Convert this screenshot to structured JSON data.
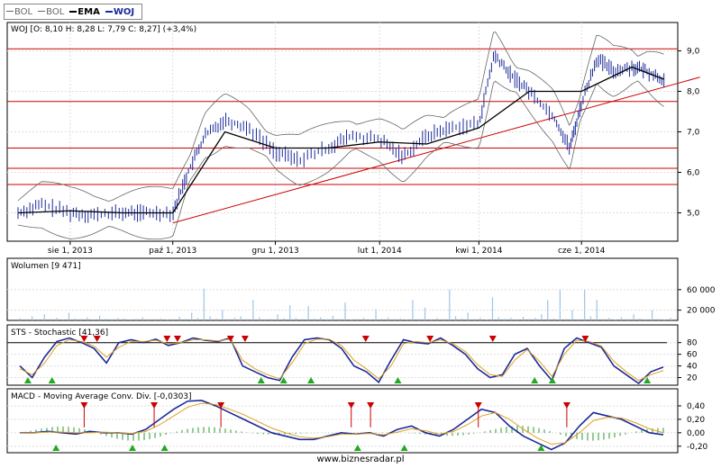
{
  "legend": [
    {
      "label": "BOL",
      "color": "#666666",
      "bold": false
    },
    {
      "label": "BOL",
      "color": "#666666",
      "bold": false
    },
    {
      "label": "EMA",
      "color": "#000000",
      "bold": true
    },
    {
      "label": "WOJ",
      "color": "#1a2a9a",
      "bold": true
    }
  ],
  "footer": "www.biznesradar.pl",
  "colors": {
    "price": "#1a2a9a",
    "bands": "#666666",
    "ema": "#000000",
    "support": "#cc0000",
    "volume": "#9ac4e8",
    "stoch_k": "#1a2a9a",
    "stoch_d": "#e0a020",
    "macd": "#1a2a9a",
    "signal": "#e0a020",
    "hist": "#2a9a2a",
    "up_marker": "#22aa22",
    "down_marker": "#cc0000",
    "grid": "#dddddd"
  },
  "chart_data": [
    {
      "type": "line",
      "title": "WOJ [O: 8,10  H: 8,28  L: 7,79  C: 8,27] (+3,4%)",
      "x_ticks": [
        "sie 1, 2013",
        "paź 1, 2013",
        "gru 1, 2013",
        "lut 1, 2014",
        "kwi 1, 2014",
        "cze 1, 2014"
      ],
      "y_ticks": [
        "5,0",
        "6,0",
        "7,0",
        "8,0",
        "9,0"
      ],
      "ylim": [
        4.3,
        9.7
      ],
      "support_levels": [
        9.05,
        7.75,
        6.6,
        6.1,
        5.7
      ],
      "trendline": {
        "from": [
          "2013-10-01",
          4.75
        ],
        "to": [
          "2014-07-20",
          8.05
        ]
      },
      "series": [
        {
          "name": "WOJ",
          "x": [
            "2013-07-01",
            "2013-07-15",
            "2013-08-01",
            "2013-08-15",
            "2013-09-01",
            "2013-09-15",
            "2013-10-01",
            "2013-10-10",
            "2013-10-20",
            "2013-11-01",
            "2013-11-15",
            "2013-12-01",
            "2013-12-15",
            "2014-01-01",
            "2014-01-15",
            "2014-02-01",
            "2014-02-15",
            "2014-03-01",
            "2014-03-15",
            "2014-04-01",
            "2014-04-10",
            "2014-04-20",
            "2014-05-01",
            "2014-05-15",
            "2014-05-25",
            "2014-06-01",
            "2014-06-10",
            "2014-06-20",
            "2014-07-01",
            "2014-07-10",
            "2014-07-20"
          ],
          "values": [
            5.0,
            5.2,
            5.0,
            4.95,
            5.0,
            5.0,
            5.0,
            6.0,
            6.9,
            7.3,
            7.1,
            6.5,
            6.3,
            6.6,
            6.9,
            6.8,
            6.4,
            6.9,
            7.1,
            7.2,
            8.9,
            8.4,
            8.0,
            7.4,
            6.6,
            7.7,
            8.8,
            8.5,
            8.6,
            8.5,
            8.27
          ]
        },
        {
          "name": "EMA",
          "x": [
            "2013-07-01",
            "2013-08-01",
            "2013-09-01",
            "2013-10-01",
            "2013-11-01",
            "2013-12-01",
            "2014-01-01",
            "2014-02-01",
            "2014-03-01",
            "2014-04-01",
            "2014-05-01",
            "2014-06-01",
            "2014-07-01",
            "2014-07-20"
          ],
          "values": [
            5.0,
            5.05,
            5.0,
            5.0,
            7.0,
            6.6,
            6.6,
            6.75,
            6.7,
            7.1,
            8.0,
            8.0,
            8.6,
            8.3
          ]
        }
      ]
    },
    {
      "type": "bar",
      "title": "Wolumen [9 471]",
      "y_ticks": [
        "20 000",
        "60 000"
      ],
      "ylim": [
        0,
        100000
      ],
      "values": [
        4000,
        3000,
        8000,
        2500,
        12000,
        3000,
        5000,
        2000,
        15000,
        4000,
        3000,
        6000,
        2000,
        9000,
        3000,
        2500,
        5000,
        4000,
        2000,
        3000,
        6000,
        2500,
        3000,
        4000,
        2000,
        2500,
        7000,
        3000,
        15000,
        5000,
        62000,
        8000,
        4000,
        20000,
        3000,
        5000,
        8000,
        3000,
        40000,
        6000,
        2500,
        3000,
        12000,
        4000,
        30000,
        5000,
        3000,
        28000,
        4000,
        6000,
        2500,
        9000,
        3000,
        35000,
        2000,
        3000,
        5000,
        2500,
        22000,
        3000,
        6000,
        3000,
        4000,
        2000,
        40000,
        3000,
        25000,
        2500,
        5000,
        3000,
        60000,
        8000,
        4000,
        15000,
        3000,
        5000,
        2000,
        45000,
        6000,
        3000,
        5000,
        2000,
        7000,
        3000,
        5000,
        12000,
        40000,
        4000,
        60000,
        3000,
        20000,
        2500,
        60000,
        8000,
        40000,
        3000,
        5000,
        2000,
        6000,
        3000,
        12000,
        4000,
        2500,
        20000,
        3000,
        2000,
        5000
      ]
    },
    {
      "type": "line",
      "title": "STS - Stochastic [41,36]",
      "y_ticks": [
        "20",
        "40",
        "60",
        "80"
      ],
      "ylim": [
        10,
        95
      ],
      "hline": 80,
      "series": [
        {
          "name": "%K",
          "values": [
            40,
            20,
            55,
            82,
            88,
            80,
            70,
            45,
            80,
            85,
            80,
            86,
            75,
            80,
            88,
            84,
            82,
            88,
            40,
            30,
            20,
            15,
            55,
            85,
            88,
            85,
            70,
            40,
            30,
            12,
            50,
            85,
            80,
            78,
            88,
            75,
            60,
            35,
            20,
            25,
            60,
            70,
            40,
            15,
            70,
            88,
            80,
            72,
            40,
            25,
            10,
            30,
            38
          ]
        },
        {
          "name": "%D",
          "values": [
            35,
            25,
            45,
            75,
            85,
            82,
            74,
            55,
            72,
            82,
            82,
            84,
            78,
            80,
            85,
            85,
            83,
            86,
            50,
            35,
            25,
            18,
            45,
            78,
            86,
            86,
            75,
            50,
            35,
            18,
            40,
            78,
            82,
            80,
            85,
            78,
            65,
            42,
            25,
            22,
            50,
            68,
            48,
            22,
            60,
            84,
            82,
            74,
            48,
            30,
            15,
            25,
            32
          ]
        }
      ],
      "markers_up": [
        10,
        40,
        300,
        328,
        362,
        470,
        640,
        662,
        780
      ],
      "markers_down": [
        80,
        96,
        183,
        196,
        262,
        280,
        430,
        510,
        588,
        703
      ]
    },
    {
      "type": "line",
      "title": "MACD - Moving Average Conv. Div. [-0,0303]",
      "y_ticks": [
        "-0,20",
        "0,00",
        "0,20",
        "0,40"
      ],
      "ylim": [
        -0.27,
        0.52
      ],
      "series": [
        {
          "name": "MACD",
          "values": [
            0.0,
            0.0,
            0.02,
            0.0,
            -0.02,
            0.02,
            0.0,
            0.0,
            -0.02,
            0.05,
            0.2,
            0.35,
            0.47,
            0.48,
            0.4,
            0.3,
            0.2,
            0.1,
            0.0,
            -0.05,
            -0.1,
            -0.1,
            -0.05,
            0.0,
            -0.02,
            0.0,
            -0.05,
            0.05,
            0.1,
            0.0,
            -0.05,
            0.05,
            0.2,
            0.35,
            0.3,
            0.1,
            -0.05,
            -0.15,
            -0.25,
            -0.15,
            0.1,
            0.3,
            0.25,
            0.2,
            0.1,
            0.0,
            -0.03
          ]
        },
        {
          "name": "Signal",
          "values": [
            0.0,
            0.0,
            0.01,
            0.01,
            0.0,
            0.0,
            0.01,
            0.0,
            -0.01,
            0.02,
            0.12,
            0.25,
            0.38,
            0.44,
            0.42,
            0.35,
            0.27,
            0.17,
            0.07,
            0.0,
            -0.06,
            -0.08,
            -0.06,
            -0.02,
            -0.02,
            -0.01,
            -0.03,
            0.01,
            0.06,
            0.03,
            -0.02,
            0.02,
            0.12,
            0.25,
            0.3,
            0.2,
            0.05,
            -0.08,
            -0.17,
            -0.15,
            0.0,
            0.18,
            0.23,
            0.22,
            0.15,
            0.06,
            0.0
          ]
        }
      ],
      "markers_up": [
        45,
        140,
        180,
        420,
        478,
        648
      ],
      "markers_down": [
        80,
        167,
        250,
        412,
        436,
        570,
        680
      ]
    }
  ]
}
